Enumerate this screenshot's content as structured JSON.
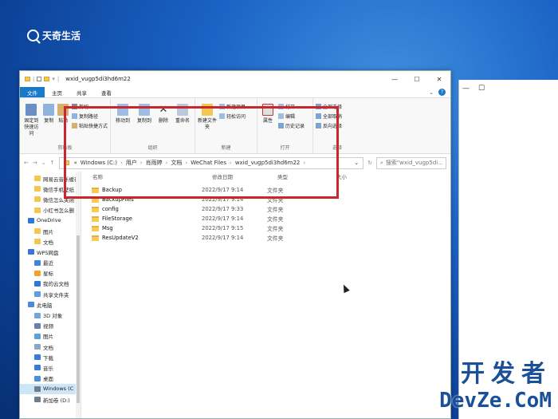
{
  "watermark": {
    "logo_text": "天奇生活",
    "site_cn": "开发者",
    "site_en": "DevZe.CoM"
  },
  "window": {
    "title": "wxid_vugp5di3hd6m22",
    "controls": [
      "—",
      "☐",
      "✕"
    ]
  },
  "ribbon": {
    "tabs": [
      "文件",
      "主页",
      "共享",
      "查看"
    ],
    "groups": {
      "clipboard": {
        "label": "剪贴板",
        "pin": "固定到快速访问",
        "copy": "复制",
        "paste": "粘贴",
        "cut": "剪切",
        "copy_path": "复制路径",
        "paste_shortcut": "粘贴快捷方式"
      },
      "organize": {
        "label": "组织",
        "move_to": "移动到",
        "copy_to": "复制到",
        "delete": "删除",
        "rename": "重命名"
      },
      "new": {
        "label": "新建",
        "new_folder": "新建文件夹",
        "new_item": "新建项目",
        "easy_access": "轻松访问"
      },
      "open": {
        "label": "打开",
        "properties": "属性",
        "open": "打开",
        "edit": "编辑",
        "history": "历史记录"
      },
      "select": {
        "label": "选择",
        "select_all": "全部选择",
        "select_none": "全部取消",
        "invert": "反向选择"
      }
    }
  },
  "address": {
    "parts": [
      "«",
      "Windows (C:)",
      "用户",
      "肖雨婷",
      "文档",
      "WeChat Files",
      "wxid_vugp5di3hd6m22"
    ],
    "search_placeholder": "搜索\"wxid_vugp5di..."
  },
  "nav": [
    {
      "label": "网易云音乐缓存",
      "icon": "folder",
      "level": "sub"
    },
    {
      "label": "微信手机壁纸",
      "icon": "folder",
      "level": "sub"
    },
    {
      "label": "微信怎么关闭",
      "icon": "folder",
      "level": "sub"
    },
    {
      "label": "小红书怎么删",
      "icon": "folder",
      "level": "sub"
    },
    {
      "label": "OneDrive",
      "icon": "cloud",
      "level": "top"
    },
    {
      "label": "图片",
      "icon": "folder",
      "level": "sub"
    },
    {
      "label": "文档",
      "icon": "folder",
      "level": "sub"
    },
    {
      "label": "WPS网盘",
      "icon": "wps",
      "level": "top"
    },
    {
      "label": "最近",
      "icon": "clock",
      "level": "sub"
    },
    {
      "label": "星标",
      "icon": "star",
      "level": "sub"
    },
    {
      "label": "我的云文档",
      "icon": "cloud",
      "level": "sub"
    },
    {
      "label": "共享文件夹",
      "icon": "share",
      "level": "sub"
    },
    {
      "label": "此电脑",
      "icon": "pc",
      "level": "top"
    },
    {
      "label": "3D 对象",
      "icon": "3d",
      "level": "sub"
    },
    {
      "label": "视频",
      "icon": "video",
      "level": "sub"
    },
    {
      "label": "图片",
      "icon": "picture",
      "level": "sub"
    },
    {
      "label": "文档",
      "icon": "doc",
      "level": "sub"
    },
    {
      "label": "下载",
      "icon": "download",
      "level": "sub"
    },
    {
      "label": "音乐",
      "icon": "music",
      "level": "sub"
    },
    {
      "label": "桌面",
      "icon": "desktop",
      "level": "sub"
    },
    {
      "label": "Windows (C",
      "icon": "drive",
      "level": "sub",
      "selected": true
    },
    {
      "label": "新加卷 (D:)",
      "icon": "drive",
      "level": "sub"
    }
  ],
  "columns": {
    "name": "名称",
    "date": "修改日期",
    "type": "类型",
    "size": "大小"
  },
  "files": [
    {
      "name": "Backup",
      "date": "2022/9/17 9:14",
      "type": "文件夹"
    },
    {
      "name": "BackupFiles",
      "date": "2022/9/17 9:14",
      "type": "文件夹"
    },
    {
      "name": "config",
      "date": "2022/9/17 9:33",
      "type": "文件夹"
    },
    {
      "name": "FileStorage",
      "date": "2022/9/17 9:14",
      "type": "文件夹"
    },
    {
      "name": "Msg",
      "date": "2022/9/17 9:15",
      "type": "文件夹"
    },
    {
      "name": "ResUpdateV2",
      "date": "2022/9/17 9:14",
      "type": "文件夹"
    }
  ],
  "colors": {
    "accent": "#1979ca",
    "highlight_border": "#c7282f",
    "folder": "#f7cd56"
  }
}
